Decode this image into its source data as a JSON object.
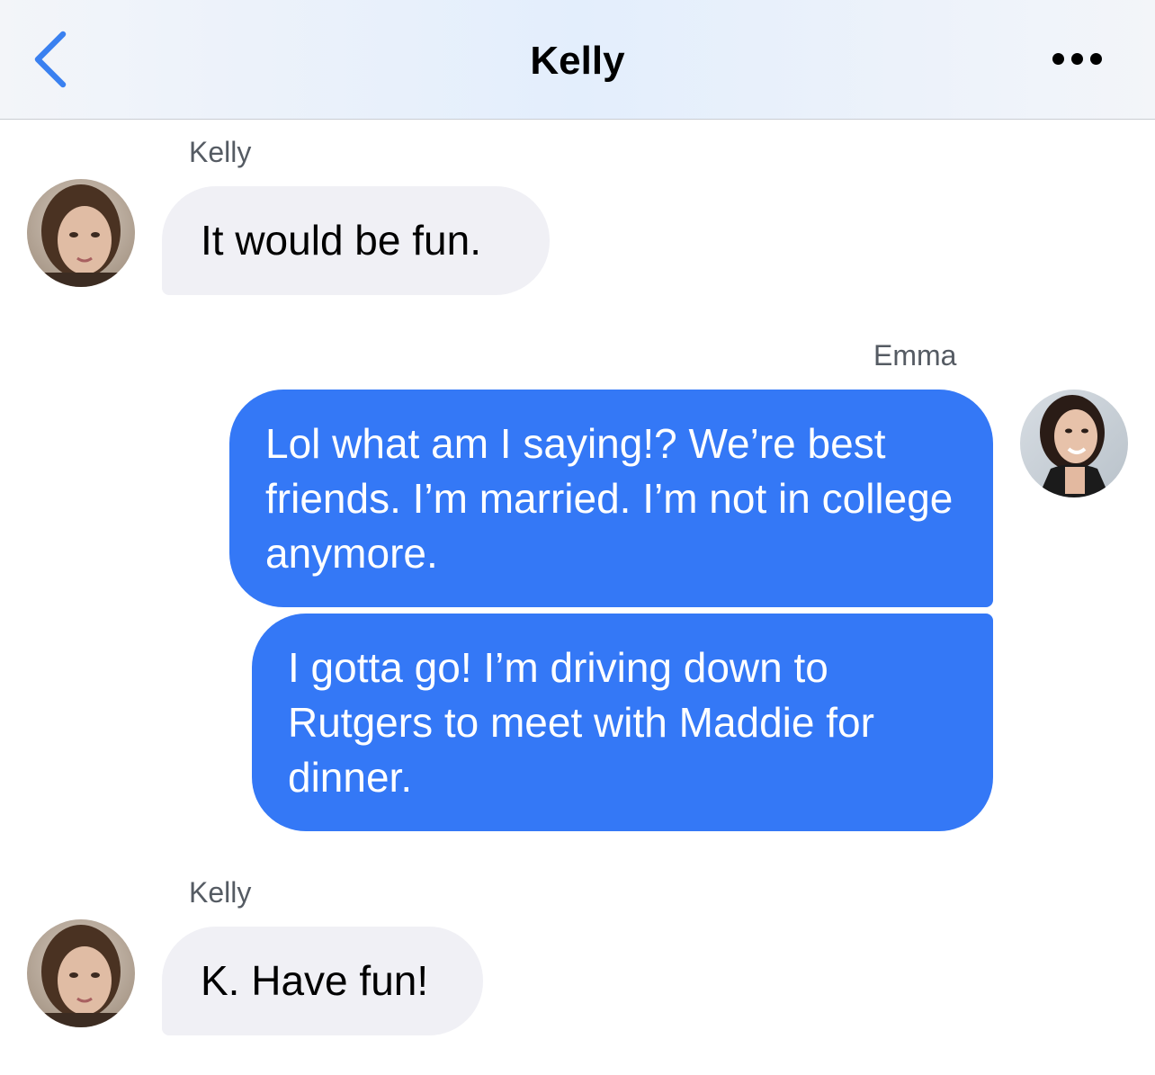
{
  "header": {
    "title": "Kelly",
    "back_icon": "chevron-left-icon",
    "more_icon": "more-dots-icon"
  },
  "colors": {
    "accent": "#3478f6",
    "incoming_bubble": "#f0f0f5",
    "back_chevron": "#3a80f0"
  },
  "messages": [
    {
      "sender": "Kelly",
      "direction": "incoming",
      "text": "It would be fun."
    },
    {
      "sender": "Emma",
      "direction": "outgoing",
      "text": "Lol what am I saying!? We’re best friends. I’m married. I’m not in college anymore."
    },
    {
      "sender": "Emma",
      "direction": "outgoing",
      "text": "I gotta go! I’m driving down to Rutgers to meet with Maddie for dinner."
    },
    {
      "sender": "Kelly",
      "direction": "incoming",
      "text": "K. Have fun!"
    }
  ]
}
